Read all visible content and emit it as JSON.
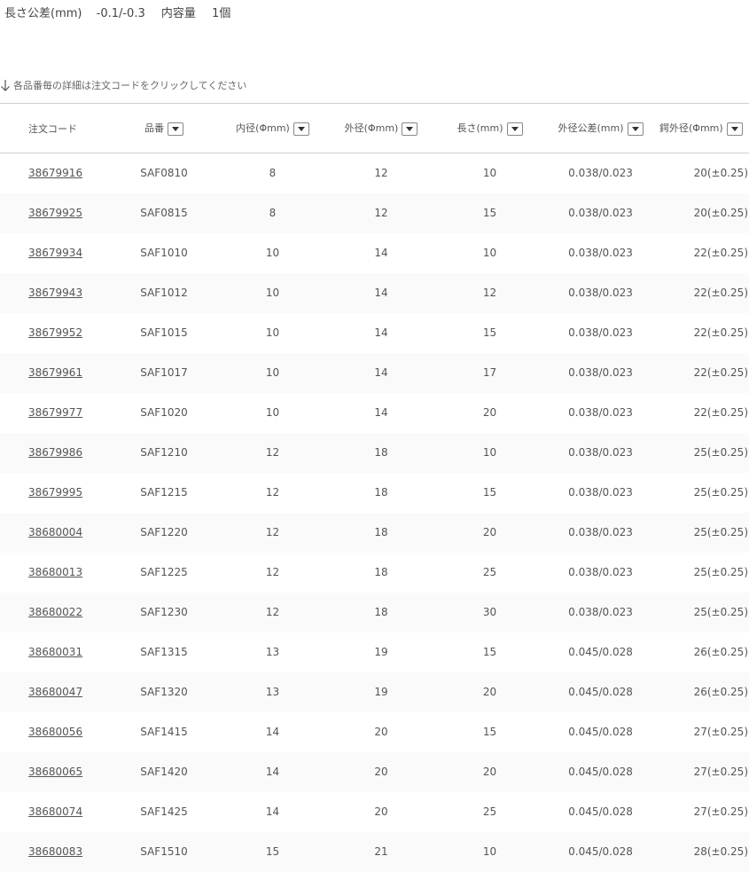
{
  "spec": {
    "length_tolerance_label": "長さ公差(mm)",
    "length_tolerance_value": "-0.1/-0.3",
    "content_label": "内容量",
    "content_value": "1個"
  },
  "hint": {
    "text": "各品番毎の詳細は注文コードをクリックしてください"
  },
  "table": {
    "headers": {
      "order_code": "注文コード",
      "part_no": "品番",
      "inner_dia": "内径(Φmm)",
      "outer_dia": "外径(Φmm)",
      "length": "長さ(mm)",
      "outer_tol": "外径公差(mm)",
      "flange_dia": "鍔外径(Φmm)"
    },
    "rows": [
      {
        "code": "38679916",
        "part": "SAF0810",
        "inner": "8",
        "outer": "12",
        "length": "10",
        "tol": "0.038/0.023",
        "flange": "20(±0.25)"
      },
      {
        "code": "38679925",
        "part": "SAF0815",
        "inner": "8",
        "outer": "12",
        "length": "15",
        "tol": "0.038/0.023",
        "flange": "20(±0.25)"
      },
      {
        "code": "38679934",
        "part": "SAF1010",
        "inner": "10",
        "outer": "14",
        "length": "10",
        "tol": "0.038/0.023",
        "flange": "22(±0.25)"
      },
      {
        "code": "38679943",
        "part": "SAF1012",
        "inner": "10",
        "outer": "14",
        "length": "12",
        "tol": "0.038/0.023",
        "flange": "22(±0.25)"
      },
      {
        "code": "38679952",
        "part": "SAF1015",
        "inner": "10",
        "outer": "14",
        "length": "15",
        "tol": "0.038/0.023",
        "flange": "22(±0.25)"
      },
      {
        "code": "38679961",
        "part": "SAF1017",
        "inner": "10",
        "outer": "14",
        "length": "17",
        "tol": "0.038/0.023",
        "flange": "22(±0.25)"
      },
      {
        "code": "38679977",
        "part": "SAF1020",
        "inner": "10",
        "outer": "14",
        "length": "20",
        "tol": "0.038/0.023",
        "flange": "22(±0.25)"
      },
      {
        "code": "38679986",
        "part": "SAF1210",
        "inner": "12",
        "outer": "18",
        "length": "10",
        "tol": "0.038/0.023",
        "flange": "25(±0.25)"
      },
      {
        "code": "38679995",
        "part": "SAF1215",
        "inner": "12",
        "outer": "18",
        "length": "15",
        "tol": "0.038/0.023",
        "flange": "25(±0.25)"
      },
      {
        "code": "38680004",
        "part": "SAF1220",
        "inner": "12",
        "outer": "18",
        "length": "20",
        "tol": "0.038/0.023",
        "flange": "25(±0.25)"
      },
      {
        "code": "38680013",
        "part": "SAF1225",
        "inner": "12",
        "outer": "18",
        "length": "25",
        "tol": "0.038/0.023",
        "flange": "25(±0.25)"
      },
      {
        "code": "38680022",
        "part": "SAF1230",
        "inner": "12",
        "outer": "18",
        "length": "30",
        "tol": "0.038/0.023",
        "flange": "25(±0.25)"
      },
      {
        "code": "38680031",
        "part": "SAF1315",
        "inner": "13",
        "outer": "19",
        "length": "15",
        "tol": "0.045/0.028",
        "flange": "26(±0.25)"
      },
      {
        "code": "38680047",
        "part": "SAF1320",
        "inner": "13",
        "outer": "19",
        "length": "20",
        "tol": "0.045/0.028",
        "flange": "26(±0.25)"
      },
      {
        "code": "38680056",
        "part": "SAF1415",
        "inner": "14",
        "outer": "20",
        "length": "15",
        "tol": "0.045/0.028",
        "flange": "27(±0.25)"
      },
      {
        "code": "38680065",
        "part": "SAF1420",
        "inner": "14",
        "outer": "20",
        "length": "20",
        "tol": "0.045/0.028",
        "flange": "27(±0.25)"
      },
      {
        "code": "38680074",
        "part": "SAF1425",
        "inner": "14",
        "outer": "20",
        "length": "25",
        "tol": "0.045/0.028",
        "flange": "27(±0.25)"
      },
      {
        "code": "38680083",
        "part": "SAF1510",
        "inner": "15",
        "outer": "21",
        "length": "10",
        "tol": "0.045/0.028",
        "flange": "28(±0.25)"
      }
    ]
  }
}
